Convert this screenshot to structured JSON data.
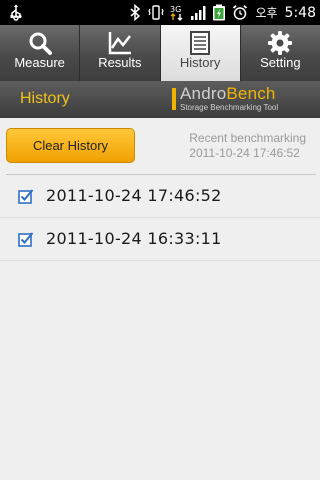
{
  "status_bar": {
    "carrier": "오후",
    "time": "5:48",
    "icons": [
      "usb-icon",
      "bluetooth-icon",
      "vibrate-icon",
      "3g-data-icon",
      "signal-icon",
      "battery-charging-icon",
      "alarm-icon"
    ]
  },
  "tabs": [
    {
      "label": "Measure",
      "icon": "magnifier-icon",
      "active": false
    },
    {
      "label": "Results",
      "icon": "line-chart-icon",
      "active": false
    },
    {
      "label": "History",
      "icon": "document-icon",
      "active": true
    },
    {
      "label": "Setting",
      "icon": "gear-icon",
      "active": false
    }
  ],
  "header": {
    "title": "History",
    "brand_part1": "Andro",
    "brand_part2": "Bench",
    "brand_subtitle": "Storage Benchmarking Tool"
  },
  "actions": {
    "clear_label": "Clear History"
  },
  "recent": {
    "label": "Recent benchmarking",
    "timestamp": "2011-10-24 17:46:52"
  },
  "history": [
    {
      "timestamp": "2011-10-24 17:46:52"
    },
    {
      "timestamp": "2011-10-24 16:33:11"
    }
  ],
  "colors": {
    "accent": "#f0b400",
    "header_title": "#f0c21a",
    "button": "#f5a800",
    "list_icon": "#2f6fc4"
  }
}
